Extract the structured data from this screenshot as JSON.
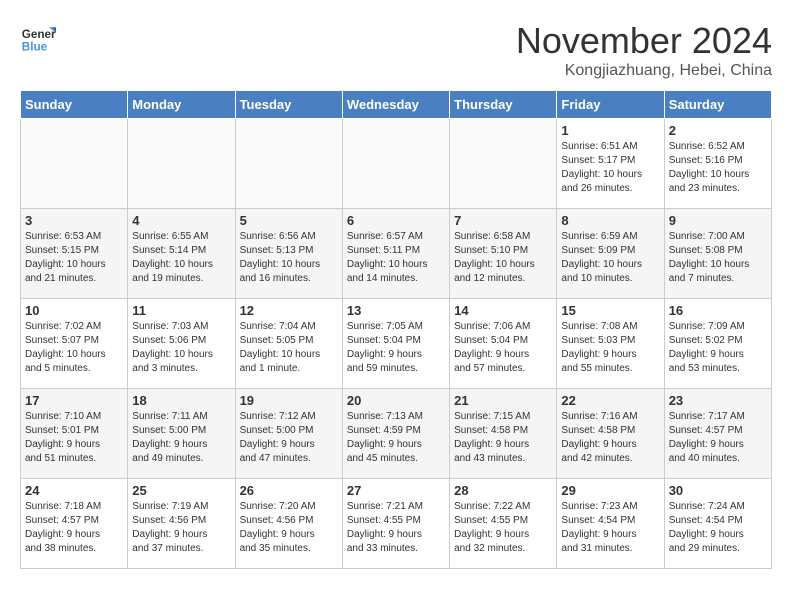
{
  "header": {
    "logo_line1": "General",
    "logo_line2": "Blue",
    "month_year": "November 2024",
    "location": "Kongjiazhuang, Hebei, China"
  },
  "weekdays": [
    "Sunday",
    "Monday",
    "Tuesday",
    "Wednesday",
    "Thursday",
    "Friday",
    "Saturday"
  ],
  "weeks": [
    [
      {
        "day": "",
        "info": ""
      },
      {
        "day": "",
        "info": ""
      },
      {
        "day": "",
        "info": ""
      },
      {
        "day": "",
        "info": ""
      },
      {
        "day": "",
        "info": ""
      },
      {
        "day": "1",
        "info": "Sunrise: 6:51 AM\nSunset: 5:17 PM\nDaylight: 10 hours\nand 26 minutes."
      },
      {
        "day": "2",
        "info": "Sunrise: 6:52 AM\nSunset: 5:16 PM\nDaylight: 10 hours\nand 23 minutes."
      }
    ],
    [
      {
        "day": "3",
        "info": "Sunrise: 6:53 AM\nSunset: 5:15 PM\nDaylight: 10 hours\nand 21 minutes."
      },
      {
        "day": "4",
        "info": "Sunrise: 6:55 AM\nSunset: 5:14 PM\nDaylight: 10 hours\nand 19 minutes."
      },
      {
        "day": "5",
        "info": "Sunrise: 6:56 AM\nSunset: 5:13 PM\nDaylight: 10 hours\nand 16 minutes."
      },
      {
        "day": "6",
        "info": "Sunrise: 6:57 AM\nSunset: 5:11 PM\nDaylight: 10 hours\nand 14 minutes."
      },
      {
        "day": "7",
        "info": "Sunrise: 6:58 AM\nSunset: 5:10 PM\nDaylight: 10 hours\nand 12 minutes."
      },
      {
        "day": "8",
        "info": "Sunrise: 6:59 AM\nSunset: 5:09 PM\nDaylight: 10 hours\nand 10 minutes."
      },
      {
        "day": "9",
        "info": "Sunrise: 7:00 AM\nSunset: 5:08 PM\nDaylight: 10 hours\nand 7 minutes."
      }
    ],
    [
      {
        "day": "10",
        "info": "Sunrise: 7:02 AM\nSunset: 5:07 PM\nDaylight: 10 hours\nand 5 minutes."
      },
      {
        "day": "11",
        "info": "Sunrise: 7:03 AM\nSunset: 5:06 PM\nDaylight: 10 hours\nand 3 minutes."
      },
      {
        "day": "12",
        "info": "Sunrise: 7:04 AM\nSunset: 5:05 PM\nDaylight: 10 hours\nand 1 minute."
      },
      {
        "day": "13",
        "info": "Sunrise: 7:05 AM\nSunset: 5:04 PM\nDaylight: 9 hours\nand 59 minutes."
      },
      {
        "day": "14",
        "info": "Sunrise: 7:06 AM\nSunset: 5:04 PM\nDaylight: 9 hours\nand 57 minutes."
      },
      {
        "day": "15",
        "info": "Sunrise: 7:08 AM\nSunset: 5:03 PM\nDaylight: 9 hours\nand 55 minutes."
      },
      {
        "day": "16",
        "info": "Sunrise: 7:09 AM\nSunset: 5:02 PM\nDaylight: 9 hours\nand 53 minutes."
      }
    ],
    [
      {
        "day": "17",
        "info": "Sunrise: 7:10 AM\nSunset: 5:01 PM\nDaylight: 9 hours\nand 51 minutes."
      },
      {
        "day": "18",
        "info": "Sunrise: 7:11 AM\nSunset: 5:00 PM\nDaylight: 9 hours\nand 49 minutes."
      },
      {
        "day": "19",
        "info": "Sunrise: 7:12 AM\nSunset: 5:00 PM\nDaylight: 9 hours\nand 47 minutes."
      },
      {
        "day": "20",
        "info": "Sunrise: 7:13 AM\nSunset: 4:59 PM\nDaylight: 9 hours\nand 45 minutes."
      },
      {
        "day": "21",
        "info": "Sunrise: 7:15 AM\nSunset: 4:58 PM\nDaylight: 9 hours\nand 43 minutes."
      },
      {
        "day": "22",
        "info": "Sunrise: 7:16 AM\nSunset: 4:58 PM\nDaylight: 9 hours\nand 42 minutes."
      },
      {
        "day": "23",
        "info": "Sunrise: 7:17 AM\nSunset: 4:57 PM\nDaylight: 9 hours\nand 40 minutes."
      }
    ],
    [
      {
        "day": "24",
        "info": "Sunrise: 7:18 AM\nSunset: 4:57 PM\nDaylight: 9 hours\nand 38 minutes."
      },
      {
        "day": "25",
        "info": "Sunrise: 7:19 AM\nSunset: 4:56 PM\nDaylight: 9 hours\nand 37 minutes."
      },
      {
        "day": "26",
        "info": "Sunrise: 7:20 AM\nSunset: 4:56 PM\nDaylight: 9 hours\nand 35 minutes."
      },
      {
        "day": "27",
        "info": "Sunrise: 7:21 AM\nSunset: 4:55 PM\nDaylight: 9 hours\nand 33 minutes."
      },
      {
        "day": "28",
        "info": "Sunrise: 7:22 AM\nSunset: 4:55 PM\nDaylight: 9 hours\nand 32 minutes."
      },
      {
        "day": "29",
        "info": "Sunrise: 7:23 AM\nSunset: 4:54 PM\nDaylight: 9 hours\nand 31 minutes."
      },
      {
        "day": "30",
        "info": "Sunrise: 7:24 AM\nSunset: 4:54 PM\nDaylight: 9 hours\nand 29 minutes."
      }
    ]
  ]
}
